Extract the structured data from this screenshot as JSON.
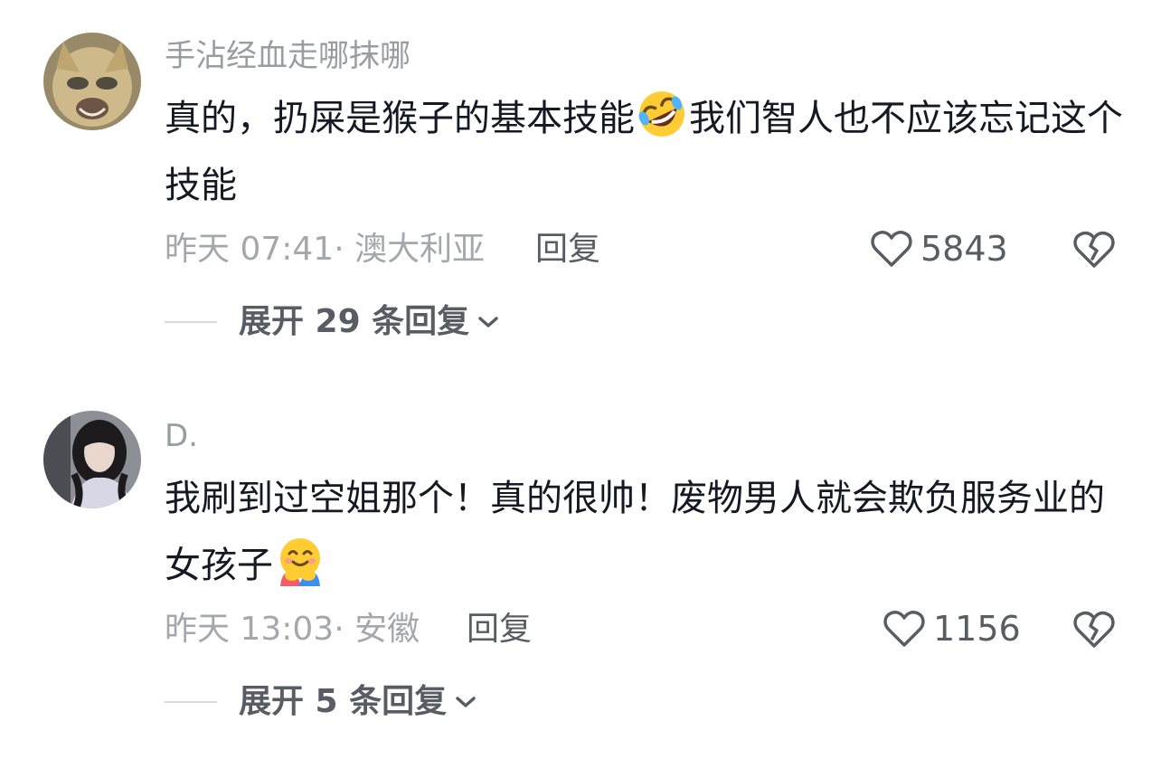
{
  "comments": [
    {
      "username": "手沾经血走哪抹哪",
      "text_part1": "真的，扔屎是猴子的基本技能",
      "emoji": "rolling-on-floor-laughing-emoji",
      "text_part2": "我们智人也不应该忘记这个技能",
      "meta": "昨天 07:41· 澳大利亚",
      "reply_label": "回复",
      "likes": "5843",
      "expand_label": "展开 29 条回复"
    },
    {
      "username": "D.",
      "text_part1": "我刷到过空姐那个！真的很帅！废物男人就会欺负服务业的女孩子",
      "emoji": "hugging-face-emoji",
      "text_part2": "",
      "meta": "昨天 13:03· 安徽",
      "reply_label": "回复",
      "likes": "1156",
      "expand_label": "展开 5 条回复"
    }
  ],
  "colors": {
    "username": "#9a9ca3",
    "body": "#161823",
    "meta": "#a5a7ad",
    "action": "#5a5c64",
    "divider": "#d8d9dc"
  }
}
